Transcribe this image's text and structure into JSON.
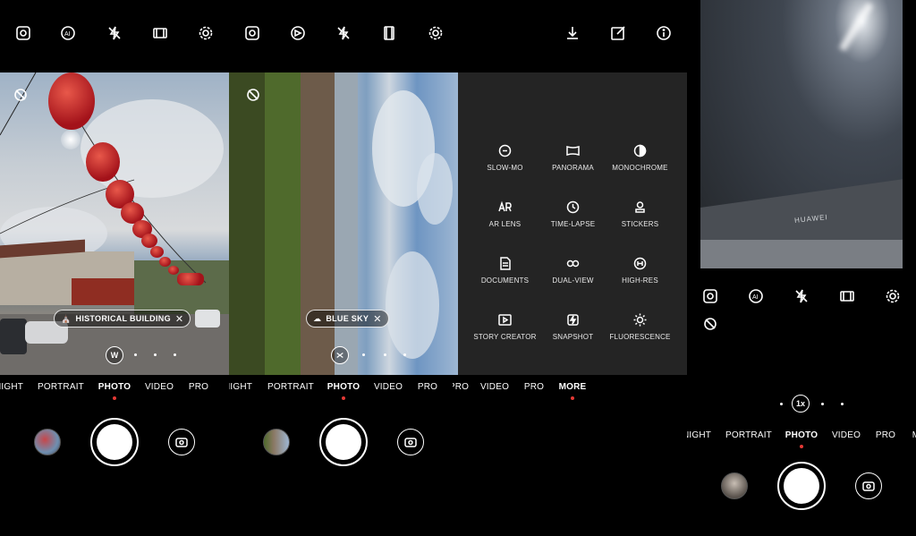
{
  "top_icons_left": [
    "hdr-icon",
    "ai-icon",
    "flash-off-icon",
    "aspect-icon",
    "settings-icon"
  ],
  "top_icons_mid": [
    "hdr-icon",
    "aperture-icon",
    "flash-off-icon",
    "film-icon",
    "settings-icon"
  ],
  "top_icons_right": [
    "download-icon",
    "edit-icon",
    "info-icon"
  ],
  "panel1": {
    "scene_label": "HISTORICAL BUILDING",
    "zoom_label": "W",
    "modes": [
      "NIGHT",
      "PORTRAIT",
      "PHOTO",
      "VIDEO",
      "PRO"
    ],
    "active_mode": "PHOTO"
  },
  "panel2": {
    "scene_label": "BLUE SKY",
    "modes": [
      "NIGHT",
      "PORTRAIT",
      "PHOTO",
      "VIDEO",
      "PRO"
    ],
    "active_mode": "PHOTO"
  },
  "panel3": {
    "more_items": [
      {
        "label": "SLOW-MO",
        "icon": "slowmo-icon"
      },
      {
        "label": "PANORAMA",
        "icon": "panorama-icon"
      },
      {
        "label": "MONOCHROME",
        "icon": "monochrome-icon"
      },
      {
        "label": "AR LENS",
        "icon": "ar-lens-icon"
      },
      {
        "label": "TIME-LAPSE",
        "icon": "timelapse-icon"
      },
      {
        "label": "STICKERS",
        "icon": "stickers-icon"
      },
      {
        "label": "DOCUMENTS",
        "icon": "documents-icon"
      },
      {
        "label": "DUAL-VIEW",
        "icon": "dual-view-icon"
      },
      {
        "label": "HIGH-RES",
        "icon": "high-res-icon"
      },
      {
        "label": "STORY CREATOR",
        "icon": "story-creator-icon"
      },
      {
        "label": "SNAPSHOT",
        "icon": "snapshot-icon"
      },
      {
        "label": "FLUORESCENCE",
        "icon": "fluorescence-icon"
      }
    ],
    "modes": [
      "PRO",
      "VIDEO",
      "PRO",
      "MORE"
    ],
    "active_mode": "MORE"
  },
  "panel4": {
    "brand_text": "HUAWEI",
    "zoom_label": "1x",
    "modes": [
      "NIGHT",
      "PORTRAIT",
      "PHOTO",
      "VIDEO",
      "PRO",
      "M"
    ],
    "active_mode": "PHOTO"
  },
  "colors": {
    "accent": "#e53935",
    "more_bg": "#242424"
  }
}
